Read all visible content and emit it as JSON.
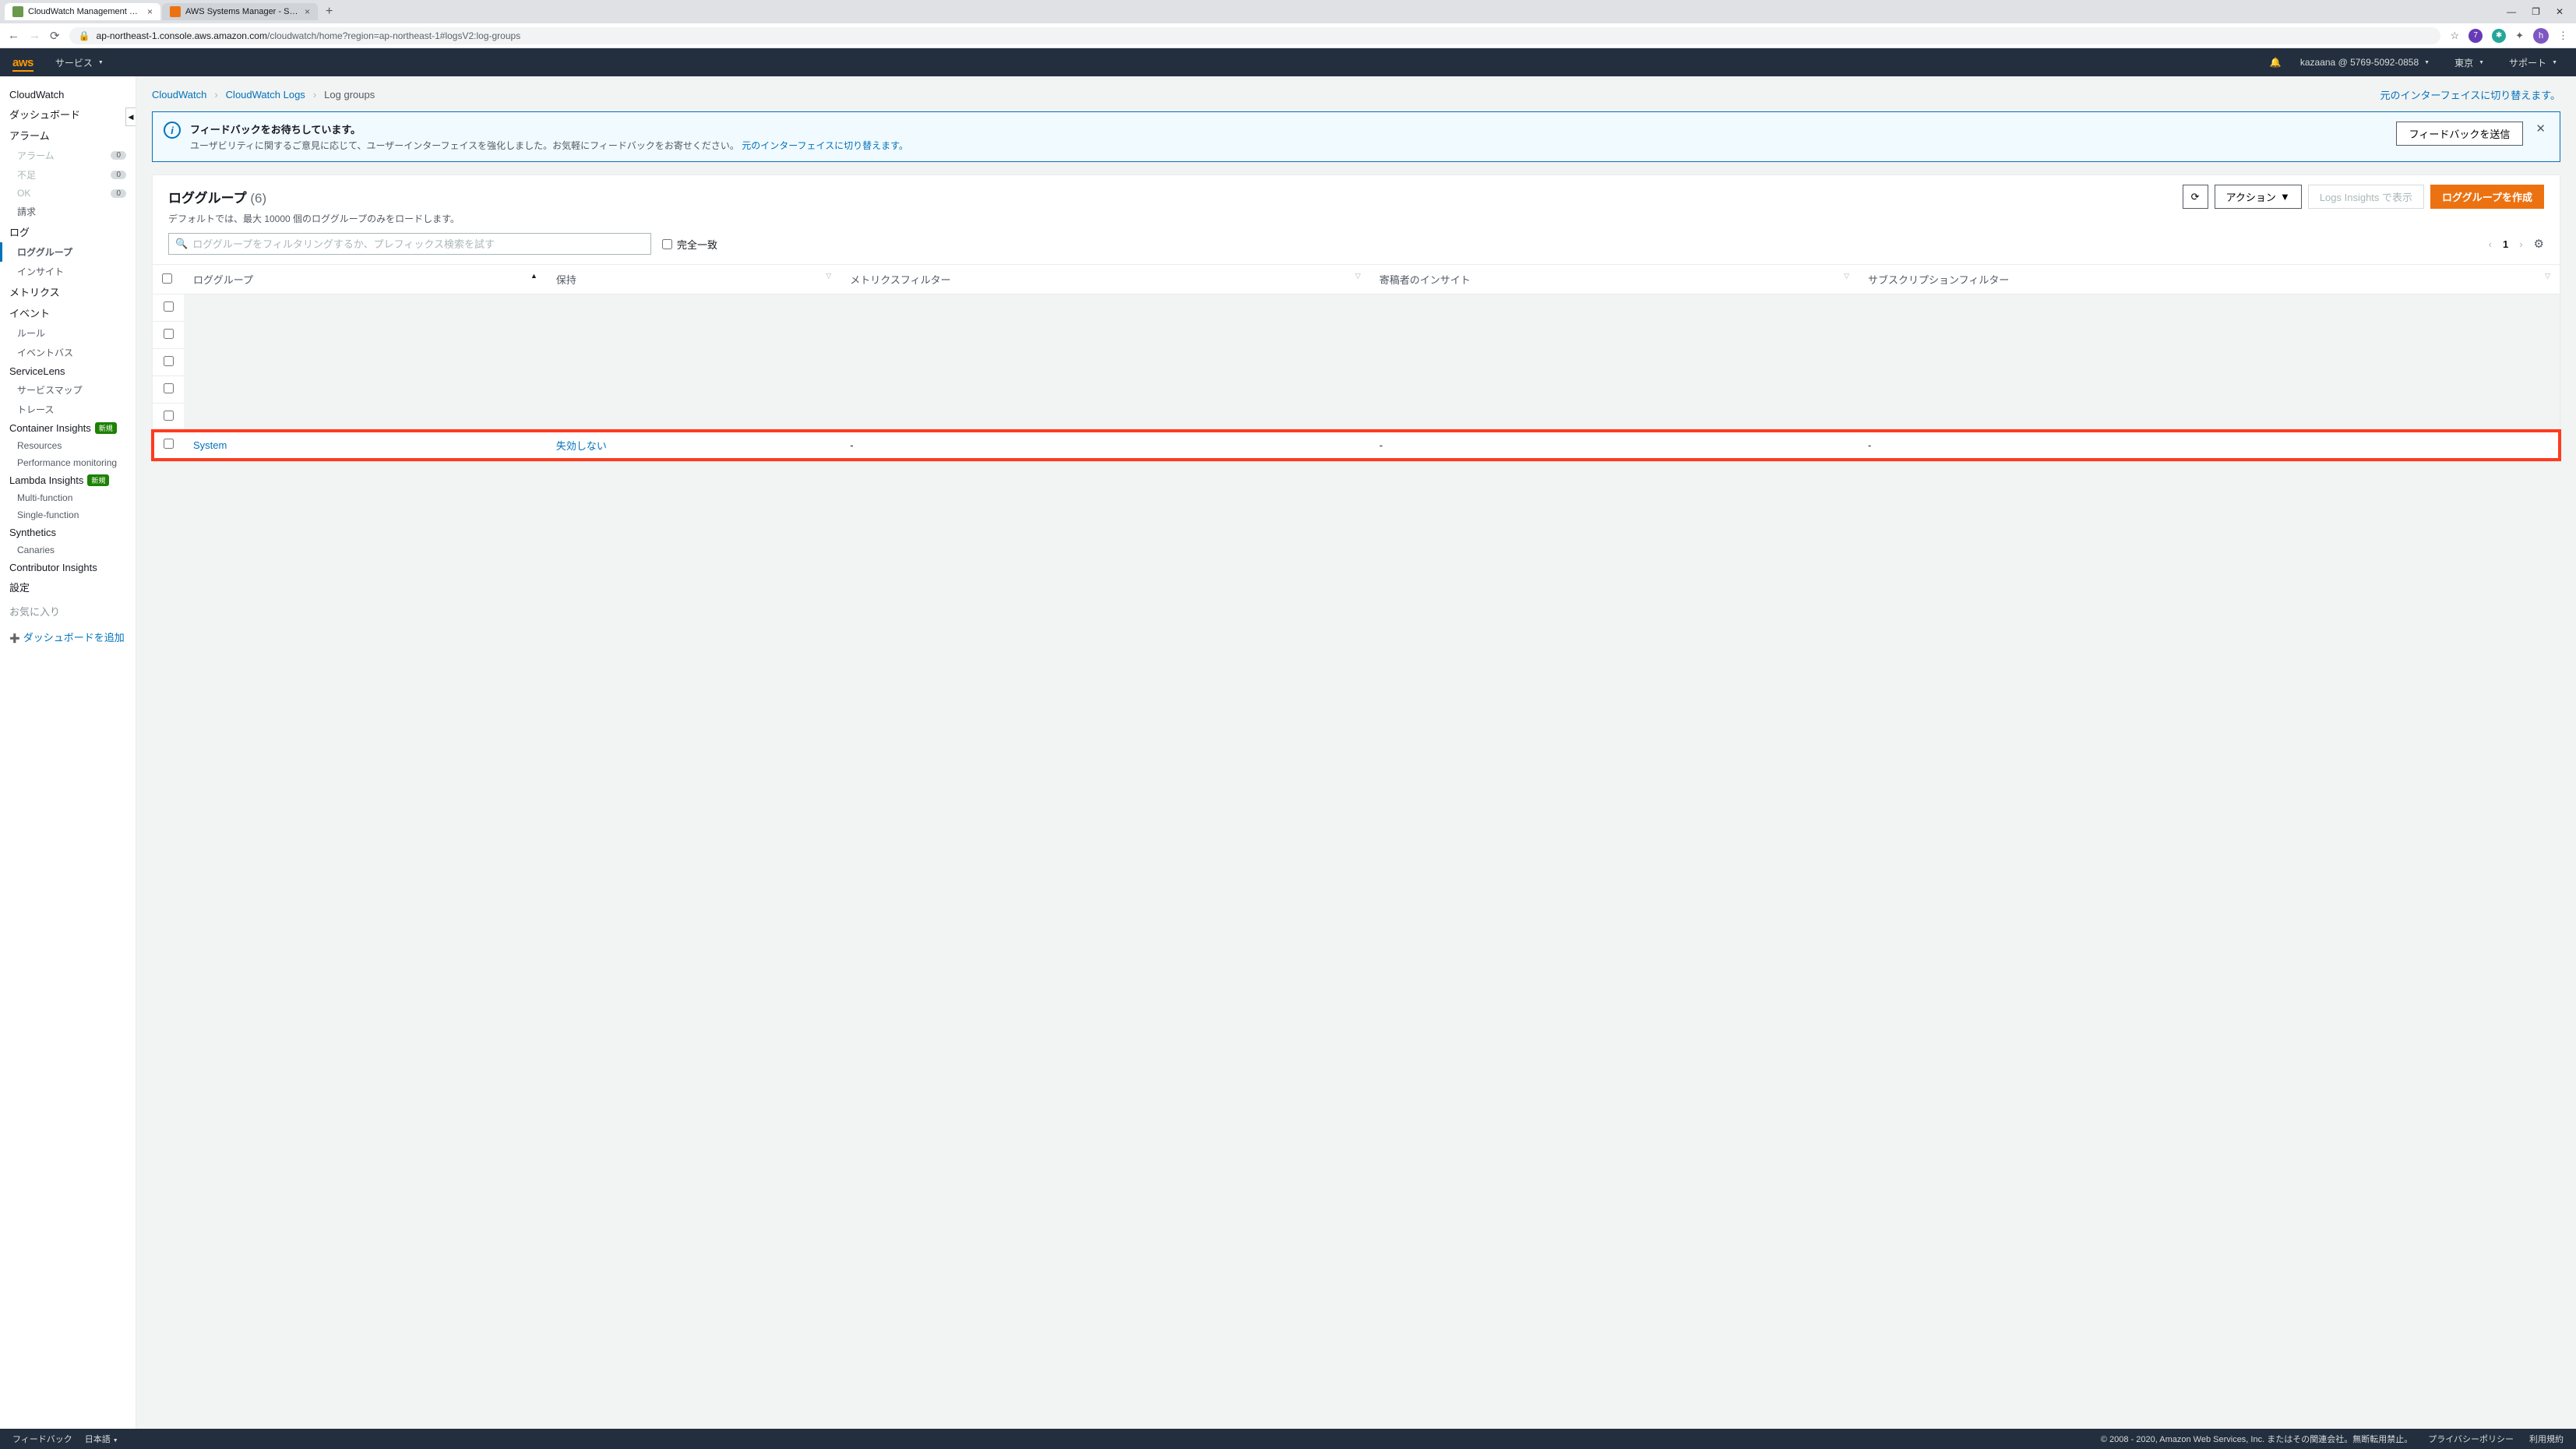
{
  "browser": {
    "tabs": [
      {
        "title": "CloudWatch Management Conso",
        "active": true,
        "favicon": "#6a994e"
      },
      {
        "title": "AWS Systems Manager - Session",
        "active": false,
        "favicon": "#ec7211"
      }
    ],
    "url_host": "ap-northeast-1.console.aws.amazon.com",
    "url_path": "/cloudwatch/home?region=ap-northeast-1#logsV2:log-groups",
    "avatar_letter": "h",
    "ext_badge": "7"
  },
  "aws_nav": {
    "services": "サービス",
    "account": "kazaana @ 5769-5092-0858",
    "region": "東京",
    "support": "サポート"
  },
  "sidebar": {
    "cloudwatch": "CloudWatch",
    "dashboard": "ダッシュボード",
    "alarms": "アラーム",
    "alarm_sub": "アラーム",
    "insufficient": "不足",
    "ok": "OK",
    "badge_zero": "0",
    "billing": "請求",
    "logs": "ログ",
    "log_groups": "ロググループ",
    "insights": "インサイト",
    "metrics": "メトリクス",
    "events": "イベント",
    "rules": "ルール",
    "event_bus": "イベントバス",
    "servicelens": "ServiceLens",
    "service_map": "サービスマップ",
    "traces": "トレース",
    "container_insights": "Container Insights",
    "new_badge": "新規",
    "resources": "Resources",
    "perf_monitoring": "Performance monitoring",
    "lambda_insights": "Lambda Insights",
    "multi_function": "Multi-function",
    "single_function": "Single-function",
    "synthetics": "Synthetics",
    "canaries": "Canaries",
    "contributor_insights": "Contributor Insights",
    "settings": "設定",
    "favorites": "お気に入り",
    "add_dashboard": "ダッシュボードを追加"
  },
  "breadcrumbs": {
    "b1": "CloudWatch",
    "b2": "CloudWatch Logs",
    "b3": "Log groups",
    "switch_link": "元のインターフェイスに切り替えます。"
  },
  "banner": {
    "title": "フィードバックをお待ちしています。",
    "text": "ユーザビリティに関するご意見に応じて、ユーザーインターフェイスを強化しました。お気軽にフィードバックをお寄せください。",
    "link": "元のインターフェイスに切り替えます。",
    "button": "フィードバックを送信"
  },
  "panel": {
    "title": "ロググループ",
    "count": "(6)",
    "subtext": "デフォルトでは、最大 10000 個のロググループのみをロードします。",
    "actions_label": "アクション",
    "insights_btn": "Logs Insights で表示",
    "create_btn": "ロググループを作成",
    "filter_placeholder": "ロググループをフィルタリングするか、プレフィックス検索を試す",
    "exact_match": "完全一致",
    "page_num": "1"
  },
  "table": {
    "col_loggroup": "ロググループ",
    "col_retention": "保持",
    "col_metric_filter": "メトリクスフィルター",
    "col_contributor": "寄稿者のインサイト",
    "col_subscription": "サブスクリプションフィルター",
    "rows": [
      {
        "name": "System",
        "retention": "失効しない",
        "metric": "-",
        "contributor": "-",
        "subscription": "-"
      }
    ]
  },
  "footer": {
    "feedback": "フィードバック",
    "language": "日本語",
    "copyright": "© 2008 - 2020, Amazon Web Services, Inc. またはその関連会社。無断転用禁止。",
    "privacy": "プライバシーポリシー",
    "terms": "利用規約"
  }
}
